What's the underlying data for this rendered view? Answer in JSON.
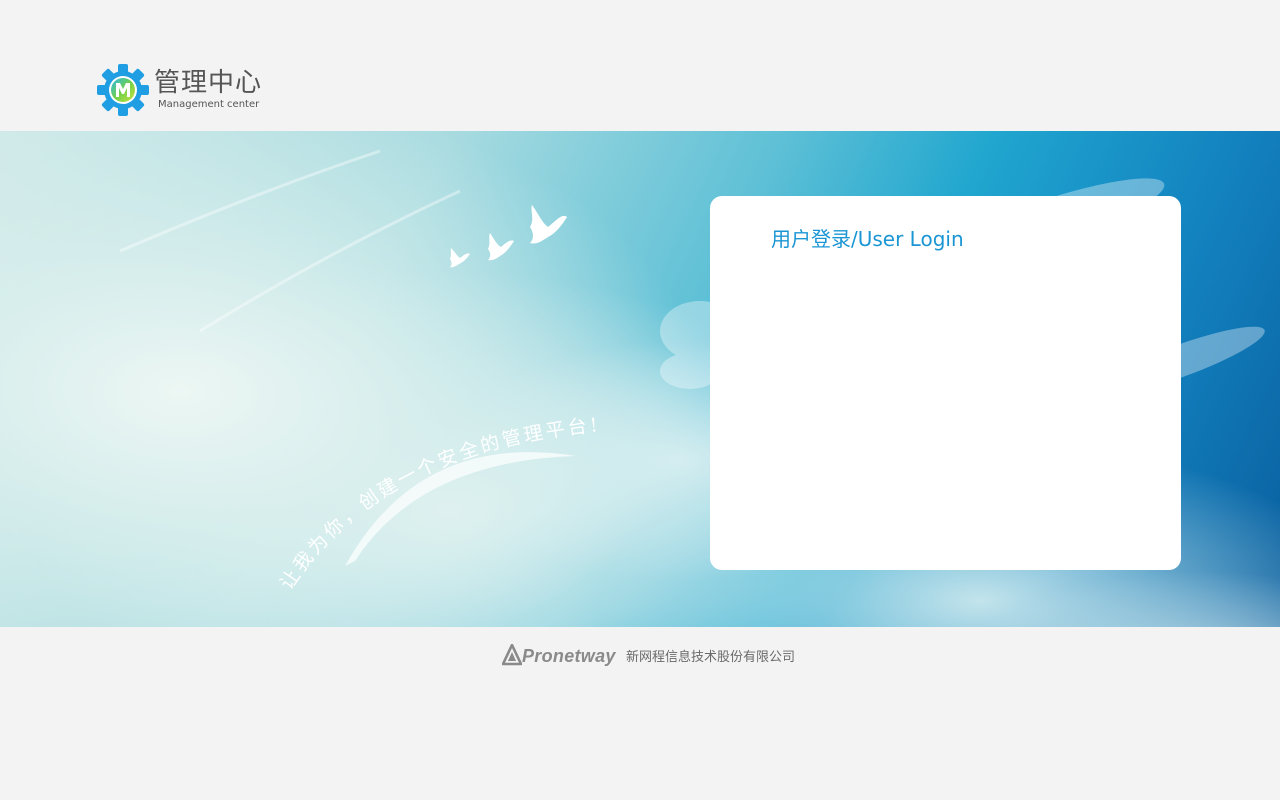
{
  "header": {
    "logo_title": "管理中心",
    "logo_subtitle": "Management center",
    "logo_icon": "gear-m-icon"
  },
  "banner": {
    "slogan": "让我为你，创建一个安全的管理平台!!",
    "decoration": "flying-birds"
  },
  "login": {
    "title": "用户登录/User Login"
  },
  "footer": {
    "brand_name": "Pronetway",
    "company_name": "新网程信息技术股份有限公司"
  },
  "colors": {
    "accent": "#1b96d4",
    "background": "#f3f3f3",
    "panel": "#ffffff",
    "sky_deep": "#0a5e9e"
  }
}
